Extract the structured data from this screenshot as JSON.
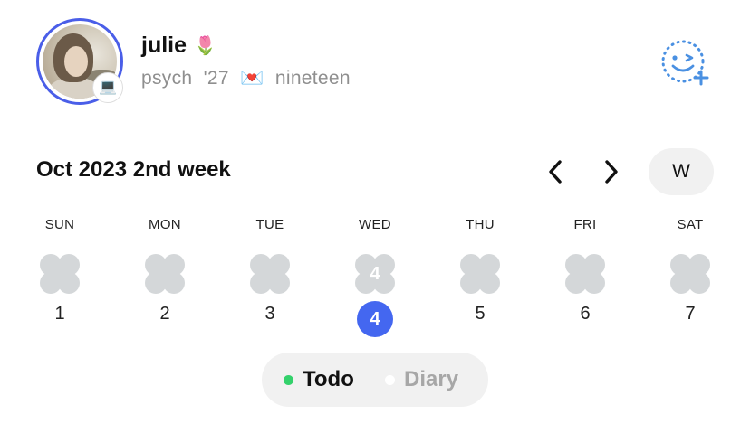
{
  "profile": {
    "name": "julie",
    "name_emoji": "🌷",
    "bio": "psych  '27  💌  nineteen",
    "badge_emoji": "💻",
    "avatar_ring_color": "#4a5ee8"
  },
  "add_friend": {
    "icon": "add-friend-smiley-icon",
    "color": "#4a90e2"
  },
  "week": {
    "title": "Oct 2023 2nd week",
    "prev_icon": "chevron-left-icon",
    "next_icon": "chevron-right-icon",
    "mode_label": "W"
  },
  "days": [
    {
      "label": "SUN",
      "number": "1",
      "count": "",
      "selected": false
    },
    {
      "label": "MON",
      "number": "2",
      "count": "",
      "selected": false
    },
    {
      "label": "TUE",
      "number": "3",
      "count": "",
      "selected": false
    },
    {
      "label": "WED",
      "number": "4",
      "count": "4",
      "selected": true
    },
    {
      "label": "THU",
      "number": "5",
      "count": "",
      "selected": false
    },
    {
      "label": "FRI",
      "number": "6",
      "count": "",
      "selected": false
    },
    {
      "label": "SAT",
      "number": "7",
      "count": "",
      "selected": false
    }
  ],
  "toggle": {
    "todo_label": "Todo",
    "diary_label": "Diary",
    "active": "Todo",
    "todo_dot_color": "#33d16b",
    "diary_dot_color": "#ffffff"
  },
  "colors": {
    "accent": "#4467f0",
    "clover": "#d4d7d9",
    "muted_text": "#8f8f8f"
  }
}
